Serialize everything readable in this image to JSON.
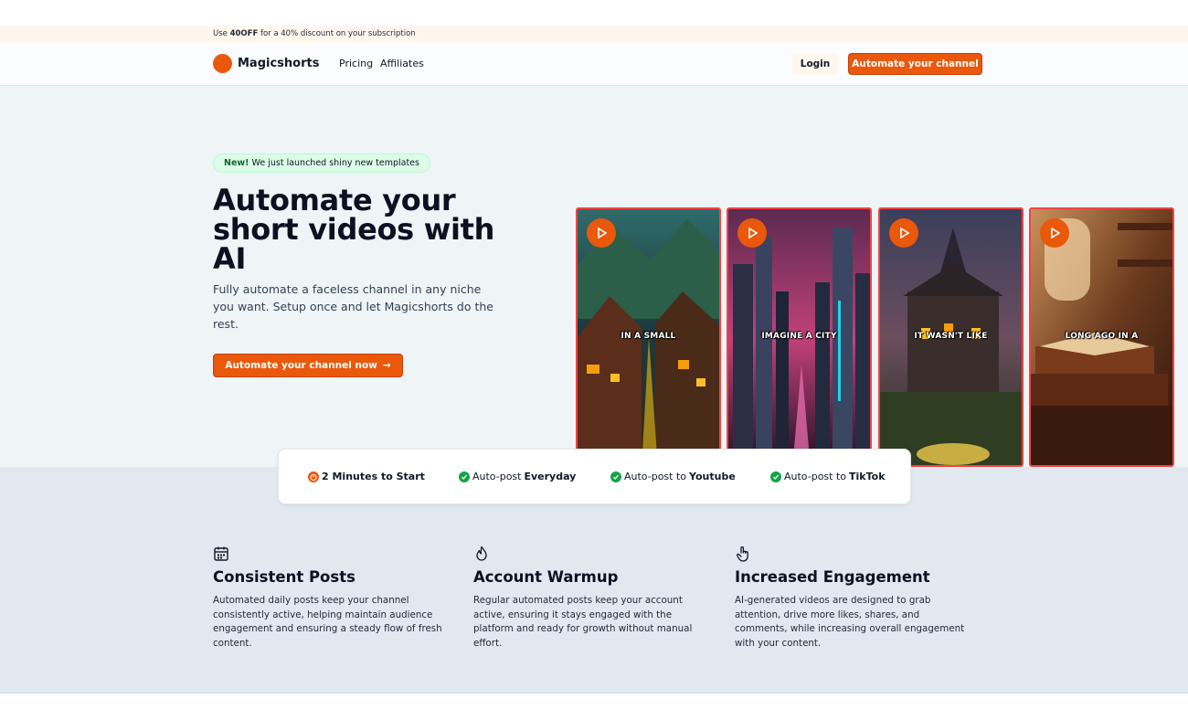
{
  "promo": {
    "prefix": "Use ",
    "code": "40OFF",
    "suffix": " for a 40% discount on your subscription"
  },
  "nav": {
    "brand": "Magicshorts",
    "links": [
      "Pricing",
      "Affiliates"
    ],
    "login": "Login",
    "cta": "Automate your channel"
  },
  "hero": {
    "badge_new": "New!",
    "badge_text": "We just launched shiny new templates",
    "title": "Automate your short videos with AI",
    "subtitle": "Fully automate a faceless channel in any niche you want. Setup once and let Magicshorts do the rest.",
    "cta": "Automate your channel now",
    "cta_arrow": "→"
  },
  "videos": [
    {
      "caption": "IN A SMALL"
    },
    {
      "caption": "IMAGINE A CITY"
    },
    {
      "caption": "IT WASN'T LIKE"
    },
    {
      "caption": "LONG AGO IN A"
    }
  ],
  "features": [
    {
      "prefix": "",
      "bold": "2 Minutes to Start"
    },
    {
      "prefix": "Auto-post ",
      "bold": "Everyday"
    },
    {
      "prefix": "Auto-post to ",
      "bold": "Youtube"
    },
    {
      "prefix": "Auto-post to ",
      "bold": "TikTok"
    }
  ],
  "columns": [
    {
      "icon": "calendar-icon",
      "title": "Consistent Posts",
      "text": "Automated daily posts keep your channel consistently active, helping maintain audience engagement and ensuring a steady flow of fresh content."
    },
    {
      "icon": "flame-icon",
      "title": "Account Warmup",
      "text": "Regular automated posts keep your account active, ensuring it stays engaged with the platform and ready for growth without manual effort."
    },
    {
      "icon": "pointer-icon",
      "title": "Increased Engagement",
      "text": "AI-generated videos are designed to grab attention, drive more likes, shares, and comments, while increasing overall engagement with your content."
    }
  ],
  "colors": {
    "accent": "#ea580c",
    "check": "#16a34a",
    "badge_bg": "#dcfce7"
  }
}
